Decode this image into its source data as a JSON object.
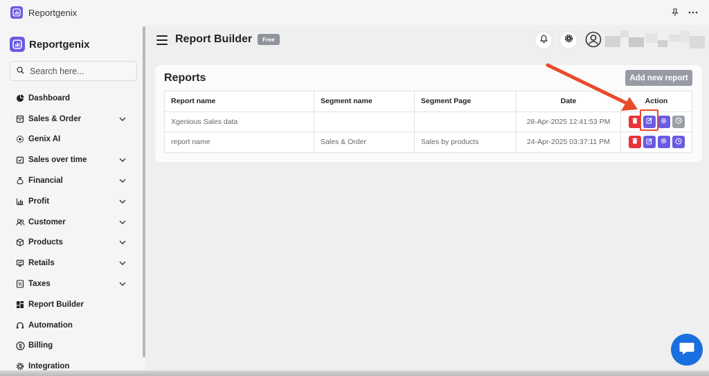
{
  "window": {
    "title": "Reportgenix"
  },
  "sidebar": {
    "brand": "Reportgenix",
    "search_placeholder": "Search here...",
    "items": [
      {
        "label": "Dashboard",
        "icon": "pie-chart-icon",
        "has_submenu": false
      },
      {
        "label": "Sales & Order",
        "icon": "receipt-icon",
        "has_submenu": true
      },
      {
        "label": "Genix AI",
        "icon": "sparkle-gear-icon",
        "has_submenu": false
      },
      {
        "label": "Sales over time",
        "icon": "calendar-check-icon",
        "has_submenu": true
      },
      {
        "label": "Financial",
        "icon": "money-bag-icon",
        "has_submenu": true
      },
      {
        "label": "Profit",
        "icon": "bar-chart-icon",
        "has_submenu": true
      },
      {
        "label": "Customer",
        "icon": "users-icon",
        "has_submenu": true
      },
      {
        "label": "Products",
        "icon": "box-icon",
        "has_submenu": true
      },
      {
        "label": "Retails",
        "icon": "presentation-board-icon",
        "has_submenu": true
      },
      {
        "label": "Taxes",
        "icon": "tax-receipt-icon",
        "has_submenu": true
      },
      {
        "label": "Report Builder",
        "icon": "grid-layout-icon",
        "has_submenu": false
      },
      {
        "label": "Automation",
        "icon": "automation-icon",
        "has_submenu": false
      },
      {
        "label": "Billing",
        "icon": "dollar-circle-icon",
        "has_submenu": false
      },
      {
        "label": "Integration",
        "icon": "gear-icon",
        "has_submenu": false
      }
    ]
  },
  "header": {
    "title": "Report Builder",
    "plan_badge": "Free"
  },
  "reports": {
    "title": "Reports",
    "add_button": "Add new report",
    "columns": [
      "Report name",
      "Segment name",
      "Segment Page",
      "Date",
      "Action"
    ],
    "rows": [
      {
        "report_name": "Xgenious Sales data",
        "segment_name": "",
        "segment_page": "",
        "date": "28-Apr-2025 12:41:53 PM",
        "schedule_active": false
      },
      {
        "report_name": "report name",
        "segment_name": "Sales & Order",
        "segment_page": "Sales by products",
        "date": "24-Apr-2025 03:37:11 PM",
        "schedule_active": true
      }
    ]
  },
  "colors": {
    "accent": "#6a5be2",
    "danger": "#e8333b",
    "annotation": "#e84a2a",
    "chat": "#1a6fe0"
  }
}
